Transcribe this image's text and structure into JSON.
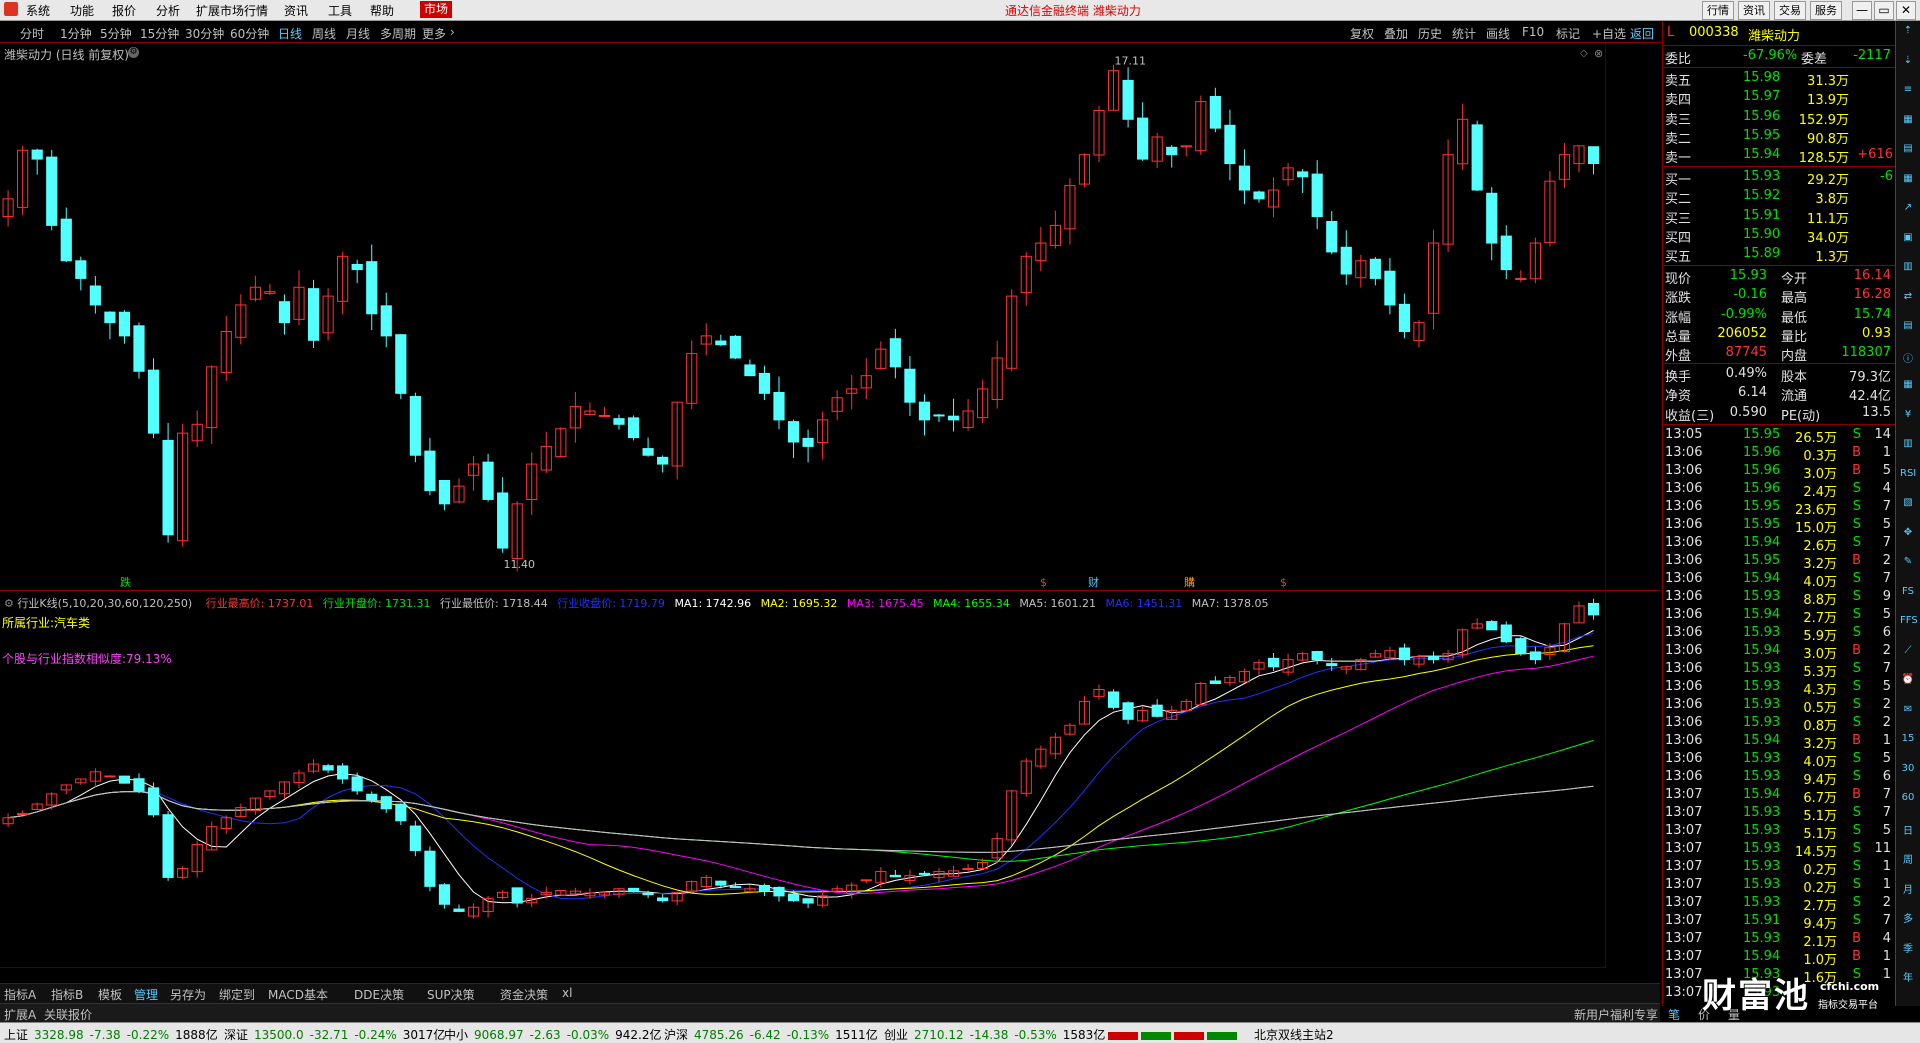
{
  "menu": {
    "items": [
      "系统",
      "功能",
      "报价",
      "分析",
      "扩展市场行情",
      "资讯",
      "工具",
      "帮助"
    ],
    "active": "市场",
    "center_title": "通达信金融终端  潍柴动力",
    "right_buttons": [
      "行情",
      "资讯",
      "交易",
      "服务"
    ],
    "win_buttons": [
      "—",
      "▭",
      "✕"
    ]
  },
  "period_bar": {
    "items": [
      "分时",
      "1分钟",
      "5分钟",
      "15分钟",
      "30分钟",
      "60分钟",
      "日线",
      "周线",
      "月线",
      "多周期",
      "更多"
    ],
    "selected": "日线",
    "right_items": [
      "复权",
      "叠加",
      "历史",
      "统计",
      "画线",
      "F10",
      "标记",
      "+自选",
      "返回"
    ],
    "right_selected": "返回"
  },
  "chart_header": {
    "title": "潍柴动力 (日线 前复权)"
  },
  "chart_data": [
    {
      "type": "candlestick",
      "title": "潍柴动力 (日线 前复权)",
      "y_ticks": [
        11.5,
        12.0,
        12.5,
        13.0,
        13.5,
        14.0,
        14.5,
        15.0,
        15.5,
        16.0,
        16.5,
        17.0
      ],
      "ylim": [
        11.3,
        17.25
      ],
      "annotations": [
        {
          "label": "17.11",
          "kind": "high"
        },
        {
          "label": "11.40",
          "kind": "low"
        }
      ],
      "markers": [
        "跌",
        "$",
        "财",
        "購",
        "$"
      ],
      "closes": [
        15.6,
        16.15,
        16.05,
        15.3,
        14.9,
        14.7,
        14.4,
        14.2,
        14.05,
        13.65,
        12.95,
        11.8,
        12.95,
        13.05,
        13.7,
        14.1,
        14.4,
        14.6,
        14.55,
        14.2,
        14.6,
        14.0,
        14.5,
        14.95,
        14.8,
        14.3,
        14.05,
        13.4,
        12.7,
        12.3,
        12.15,
        12.35,
        12.6,
        12.2,
        11.65,
        12.15,
        12.6,
        12.8,
        13.0,
        13.25,
        13.2,
        13.15,
        13.05,
        12.9,
        12.7,
        12.6,
        13.3,
        13.85,
        14.05,
        13.95,
        13.8,
        13.6,
        13.4,
        13.1,
        12.85,
        12.8,
        13.1,
        13.35,
        13.45,
        13.6,
        13.9,
        13.7,
        13.3,
        13.1,
        13.15,
        13.1,
        13.2,
        13.45,
        13.8,
        14.5,
        14.95,
        15.1,
        15.3,
        15.75,
        16.1,
        16.6,
        17.05,
        16.5,
        16.05,
        16.3,
        16.1,
        16.2,
        16.7,
        16.4,
        16.0,
        15.7,
        15.6,
        15.7,
        15.95,
        15.85,
        15.4,
        15.0,
        14.75,
        14.9,
        14.7,
        14.4,
        14.1,
        14.2,
        15.1,
        16.1,
        16.5,
        15.7,
        15.1,
        14.8,
        14.7,
        15.1,
        15.8,
        16.1,
        16.2,
        16.0
      ],
      "price_bars": 110
    },
    {
      "type": "candlestick",
      "title": "行业K线(5,10,20,30,60,120,250)",
      "y_ticks": [
        1200,
        1250,
        1300,
        1350,
        1400,
        1450,
        1500,
        1550,
        1600,
        1650,
        1700
      ],
      "ylim": [
        1150,
        1745
      ],
      "x_ticks": [
        "2019年",
        "2",
        "3",
        "4",
        "5",
        "6",
        "7",
        "8",
        "9",
        "10"
      ],
      "period_label": "日线",
      "closes": [
        1375,
        1382,
        1398,
        1415,
        1430,
        1440,
        1452,
        1445,
        1433,
        1420,
        1380,
        1275,
        1290,
        1330,
        1360,
        1375,
        1392,
        1408,
        1420,
        1435,
        1450,
        1465,
        1455,
        1440,
        1420,
        1405,
        1390,
        1370,
        1320,
        1260,
        1230,
        1218,
        1225,
        1240,
        1250,
        1232,
        1240,
        1250,
        1253,
        1252,
        1249,
        1250,
        1256,
        1251,
        1246,
        1236,
        1250,
        1268,
        1275,
        1262,
        1258,
        1256,
        1252,
        1244,
        1236,
        1232,
        1244,
        1256,
        1262,
        1271,
        1285,
        1276,
        1278,
        1280,
        1285,
        1286,
        1290,
        1300,
        1340,
        1420,
        1470,
        1490,
        1510,
        1530,
        1570,
        1590,
        1560,
        1540,
        1555,
        1545,
        1555,
        1570,
        1600,
        1600,
        1610,
        1620,
        1635,
        1628,
        1640,
        1650,
        1640,
        1630,
        1628,
        1640,
        1650,
        1655,
        1640,
        1645,
        1640,
        1650,
        1690,
        1700,
        1690,
        1670,
        1650,
        1640,
        1660,
        1700,
        1730,
        1715
      ],
      "ma_series": [
        {
          "name": "MA1",
          "label": "MA1: 1742.96",
          "color": "#ffffff"
        },
        {
          "name": "MA2",
          "label": "MA2: 1695.32",
          "color": "#ffff00"
        },
        {
          "name": "MA3",
          "label": "MA3: 1675.45",
          "color": "#ff00ff"
        },
        {
          "name": "MA4",
          "label": "MA4: 1655.34",
          "color": "#00ff00"
        },
        {
          "name": "MA5",
          "label": "MA5: 1601.21",
          "color": "#c0c0c0"
        },
        {
          "name": "MA6",
          "label": "MA6: 1451.31",
          "color": "#0000ff"
        },
        {
          "name": "MA7",
          "label": "MA7: 1378.05",
          "color": "#c0c0c0"
        }
      ]
    }
  ],
  "indicator_header": {
    "title": "行业K线(5,10,20,30,60,120,250)",
    "high_label": "行业最高价: 1737.01",
    "open_label": "行业开盘价: 1731.31",
    "low_label": "行业最低价: 1718.44",
    "close_label": "行业收盘价: 1719.79",
    "ma_labels": [
      "MA1: 1742.96",
      "MA2: 1695.32",
      "MA3: 1675.45",
      "MA4: 1655.34",
      "MA5: 1601.21",
      "MA6: 1451.31",
      "MA7: 1378.05"
    ],
    "industry_label": "所属行业:汽车类",
    "correlation_label": "个股与行业指数相似度:79.13%"
  },
  "quote_panel": {
    "code": "000338",
    "name": "潍柴动力",
    "prefix": "L",
    "weibi_label": "委比",
    "weibi_value": "-67.96%",
    "weicha_label": "委差",
    "weicha_value": "-2117",
    "asks": [
      {
        "label": "卖五",
        "price": "15.98",
        "vol": "31.3万",
        "chg": ""
      },
      {
        "label": "卖四",
        "price": "15.97",
        "vol": "13.9万",
        "chg": ""
      },
      {
        "label": "卖三",
        "price": "15.96",
        "vol": "152.9万",
        "chg": ""
      },
      {
        "label": "卖二",
        "price": "15.95",
        "vol": "90.8万",
        "chg": ""
      },
      {
        "label": "卖一",
        "price": "15.94",
        "vol": "128.5万",
        "chg": "+616"
      }
    ],
    "bids": [
      {
        "label": "买一",
        "price": "15.93",
        "vol": "29.2万",
        "chg": "-6"
      },
      {
        "label": "买二",
        "price": "15.92",
        "vol": "3.8万",
        "chg": ""
      },
      {
        "label": "买三",
        "price": "15.91",
        "vol": "11.1万",
        "chg": ""
      },
      {
        "label": "买四",
        "price": "15.90",
        "vol": "34.0万",
        "chg": ""
      },
      {
        "label": "买五",
        "price": "15.89",
        "vol": "1.3万",
        "chg": ""
      }
    ],
    "stats": [
      {
        "l1": "现价",
        "v1": "15.93",
        "l2": "今开",
        "v2": "16.14",
        "c1": "grn",
        "c2": "red"
      },
      {
        "l1": "涨跌",
        "v1": "-0.16",
        "l2": "最高",
        "v2": "16.28",
        "c1": "grn",
        "c2": "red"
      },
      {
        "l1": "涨幅",
        "v1": "-0.99%",
        "l2": "最低",
        "v2": "15.74",
        "c1": "grn",
        "c2": "grn"
      },
      {
        "l1": "总量",
        "v1": "206052",
        "l2": "量比",
        "v2": "0.93",
        "c1": "yel",
        "c2": "yel"
      },
      {
        "l1": "外盘",
        "v1": "87745",
        "l2": "内盘",
        "v2": "118307",
        "c1": "red",
        "c2": "grn"
      }
    ],
    "stats2": [
      {
        "l1": "换手",
        "v1": "0.49%",
        "l2": "股本",
        "v2": "79.3亿"
      },
      {
        "l1": "净资",
        "v1": "6.14",
        "l2": "流通",
        "v2": "42.4亿"
      },
      {
        "l1": "收益(三)",
        "v1": "0.590",
        "l2": "PE(动)",
        "v2": "13.5"
      }
    ],
    "ticks": [
      {
        "t": "13:05",
        "p": "15.95",
        "v": "26.5万",
        "s": "S",
        "n": "14"
      },
      {
        "t": "13:06",
        "p": "15.96",
        "v": "0.3万",
        "s": "B",
        "n": "1"
      },
      {
        "t": "13:06",
        "p": "15.96",
        "v": "3.0万",
        "s": "B",
        "n": "5"
      },
      {
        "t": "13:06",
        "p": "15.96",
        "v": "2.4万",
        "s": "S",
        "n": "4"
      },
      {
        "t": "13:06",
        "p": "15.95",
        "v": "23.6万",
        "s": "S",
        "n": "7"
      },
      {
        "t": "13:06",
        "p": "15.95",
        "v": "15.0万",
        "s": "S",
        "n": "5"
      },
      {
        "t": "13:06",
        "p": "15.94",
        "v": "2.6万",
        "s": "S",
        "n": "7"
      },
      {
        "t": "13:06",
        "p": "15.95",
        "v": "3.2万",
        "s": "B",
        "n": "2"
      },
      {
        "t": "13:06",
        "p": "15.94",
        "v": "4.0万",
        "s": "S",
        "n": "7"
      },
      {
        "t": "13:06",
        "p": "15.93",
        "v": "8.8万",
        "s": "S",
        "n": "9"
      },
      {
        "t": "13:06",
        "p": "15.94",
        "v": "2.7万",
        "s": "S",
        "n": "5"
      },
      {
        "t": "13:06",
        "p": "15.93",
        "v": "5.9万",
        "s": "S",
        "n": "6"
      },
      {
        "t": "13:06",
        "p": "15.94",
        "v": "3.0万",
        "s": "B",
        "n": "2"
      },
      {
        "t": "13:06",
        "p": "15.93",
        "v": "5.3万",
        "s": "S",
        "n": "7"
      },
      {
        "t": "13:06",
        "p": "15.93",
        "v": "4.3万",
        "s": "S",
        "n": "5"
      },
      {
        "t": "13:06",
        "p": "15.93",
        "v": "0.5万",
        "s": "S",
        "n": "2"
      },
      {
        "t": "13:06",
        "p": "15.93",
        "v": "0.8万",
        "s": "S",
        "n": "2"
      },
      {
        "t": "13:06",
        "p": "15.94",
        "v": "3.2万",
        "s": "B",
        "n": "1"
      },
      {
        "t": "13:06",
        "p": "15.93",
        "v": "4.0万",
        "s": "S",
        "n": "5"
      },
      {
        "t": "13:06",
        "p": "15.93",
        "v": "9.4万",
        "s": "S",
        "n": "6"
      },
      {
        "t": "13:07",
        "p": "15.94",
        "v": "6.7万",
        "s": "B",
        "n": "7"
      },
      {
        "t": "13:07",
        "p": "15.93",
        "v": "5.1万",
        "s": "S",
        "n": "7"
      },
      {
        "t": "13:07",
        "p": "15.93",
        "v": "5.1万",
        "s": "S",
        "n": "5"
      },
      {
        "t": "13:07",
        "p": "15.93",
        "v": "14.5万",
        "s": "S",
        "n": "11"
      },
      {
        "t": "13:07",
        "p": "15.93",
        "v": "0.2万",
        "s": "S",
        "n": "1"
      },
      {
        "t": "13:07",
        "p": "15.93",
        "v": "0.2万",
        "s": "S",
        "n": "1"
      },
      {
        "t": "13:07",
        "p": "15.93",
        "v": "2.7万",
        "s": "S",
        "n": "2"
      },
      {
        "t": "13:07",
        "p": "15.91",
        "v": "9.4万",
        "s": "S",
        "n": "7"
      },
      {
        "t": "13:07",
        "p": "15.93",
        "v": "2.1万",
        "s": "B",
        "n": "4"
      },
      {
        "t": "13:07",
        "p": "15.94",
        "v": "1.0万",
        "s": "B",
        "n": "1"
      },
      {
        "t": "13:07",
        "p": "15.93",
        "v": "1.6万",
        "s": "S",
        "n": "1"
      },
      {
        "t": "13:07",
        "p": "15.93",
        "v": "",
        "s": "",
        "n": ""
      }
    ]
  },
  "sidebar_icons": [
    "up-icon",
    "down-icon",
    "list-icon",
    "chart-icon",
    "volume-icon",
    "grid-icon",
    "trend-icon",
    "box-icon",
    "bar-icon",
    "compare-icon",
    "doc-icon",
    "info-icon",
    "table-icon",
    "price-icon",
    "book-icon",
    "rsi-icon",
    "indicator-icon",
    "move-icon",
    "draw-icon",
    "fs-icon",
    "ffs-icon",
    "line-icon",
    "alarm-icon",
    "note-icon",
    "15-icon",
    "30-icon",
    "60-icon",
    "day-icon",
    "week-icon",
    "month-icon",
    "multi-icon",
    "season-icon",
    "year-icon"
  ],
  "sidebar_labels": [
    "",
    "",
    "",
    "",
    "",
    "",
    "",
    "",
    "",
    "",
    "",
    "",
    "",
    "",
    "",
    "RSI",
    "",
    "",
    "",
    "FS",
    "FFS",
    "",
    "",
    "",
    "15",
    "30",
    "60",
    "日",
    "周",
    "月",
    "多",
    "季",
    "年"
  ],
  "tabs": [
    "指标A",
    "指标B",
    "模板",
    "管理",
    "另存为",
    "绑定到",
    "MACD基本",
    "DDE决策",
    "SUP决策",
    "资金决策",
    "xl"
  ],
  "tabs_selected": "管理",
  "tabs2": [
    "扩展A",
    "关联报价"
  ],
  "tabs2_right": [
    "新用户福利专享",
    "笔",
    "价",
    "量"
  ],
  "watermark": {
    "text": "财富池",
    "sub": "指标交易平台",
    "url": "cfchi.com"
  },
  "status": {
    "items": [
      {
        "name": "上证",
        "value": "3328.98",
        "chg": "-7.38",
        "pct": "-0.22%",
        "amt": "1888亿"
      },
      {
        "name": "深证",
        "value": "13500.0",
        "chg": "-32.71",
        "pct": "-0.24%",
        "amt": "3017亿"
      },
      {
        "name": "中小",
        "value": "9068.97",
        "chg": "-2.63",
        "pct": "-0.03%",
        "amt": "942.2亿"
      },
      {
        "name": "沪深",
        "value": "4785.26",
        "chg": "-6.42",
        "pct": "-0.13%",
        "amt": "1511亿"
      },
      {
        "name": "创业",
        "value": "2710.12",
        "chg": "-14.38",
        "pct": "-0.53%",
        "amt": "1583亿"
      }
    ],
    "server": "北京双线主站2"
  }
}
